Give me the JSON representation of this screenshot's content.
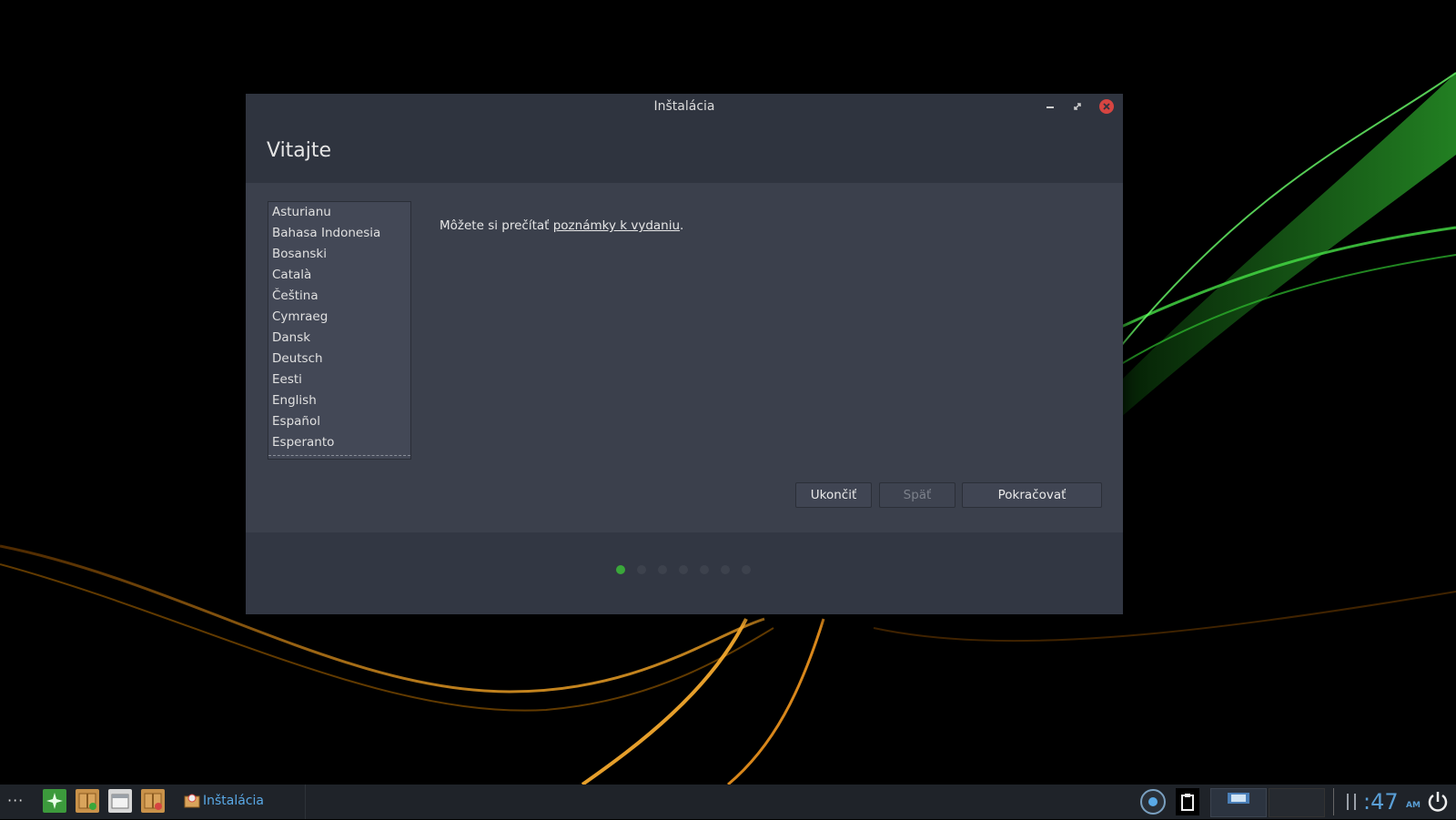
{
  "window": {
    "title": "Inštalácia",
    "page_title": "Vitajte",
    "languages": [
      "Asturianu",
      "Bahasa Indonesia",
      "Bosanski",
      "Català",
      "Čeština",
      "Cymraeg",
      "Dansk",
      "Deutsch",
      "Eesti",
      "English",
      "Español",
      "Esperanto"
    ],
    "notes_prefix": "Môžete si prečítať ",
    "notes_link": "poznámky k vydaniu",
    "notes_suffix": ".",
    "buttons": {
      "quit": "Ukončiť",
      "back": "Späť",
      "continue": "Pokračovať"
    },
    "progress": {
      "current_step": 1,
      "total_steps": 7
    }
  },
  "taskbar": {
    "menu_label": "···",
    "active_app": "Inštalácia",
    "clock_time": ":47",
    "clock_ampm": "AM",
    "colors": {
      "accent": "#5aa9e6",
      "active_dot": "#3aa73a",
      "close": "#d64541"
    }
  }
}
